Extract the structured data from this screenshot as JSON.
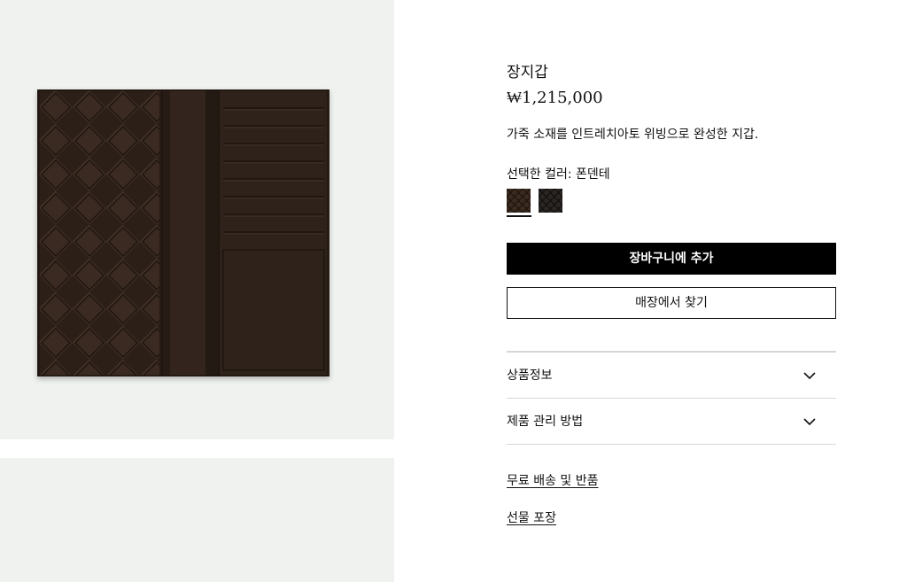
{
  "product": {
    "name": "장지갑",
    "price": "₩1,215,000",
    "description": "가죽 소재를 인트레치아토 위빙으로 완성한 지갑.",
    "selected_color_label": "선택한 컬러:",
    "selected_color_value": "폰덴테",
    "swatches": [
      {
        "name": "폰덴테",
        "color": "#3b2a20",
        "selected": true
      },
      {
        "name": "dark-weave",
        "color": "#2a2623",
        "selected": false
      }
    ]
  },
  "actions": {
    "add_to_cart": "장바구니에 추가",
    "find_in_store": "매장에서 찾기"
  },
  "accordion": [
    {
      "label": "상품정보",
      "icon": "chevron-down-icon"
    },
    {
      "label": "제품 관리 방법",
      "icon": "chevron-down-icon"
    }
  ],
  "links": {
    "shipping_returns": "무료 배송 및 반품",
    "gift_wrapping": "선물 포장"
  },
  "colors": {
    "image_background": "#f0f2f0",
    "wallet_leather": "#2e2119",
    "primary_button": "#000000"
  }
}
